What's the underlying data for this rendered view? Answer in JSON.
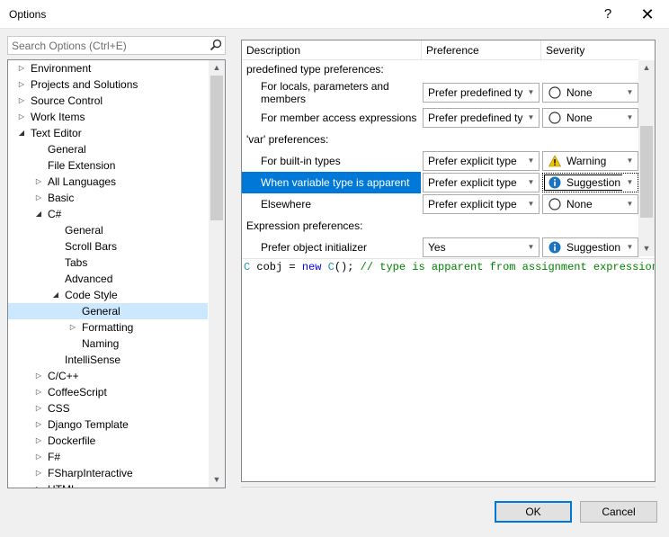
{
  "window": {
    "title": "Options",
    "help_label": "?",
    "close_label": "✕"
  },
  "search": {
    "placeholder": "Search Options (Ctrl+E)"
  },
  "tree": {
    "items": [
      {
        "label": "Environment",
        "level": 0,
        "glyph": "▷"
      },
      {
        "label": "Projects and Solutions",
        "level": 0,
        "glyph": "▷"
      },
      {
        "label": "Source Control",
        "level": 0,
        "glyph": "▷"
      },
      {
        "label": "Work Items",
        "level": 0,
        "glyph": "▷"
      },
      {
        "label": "Text Editor",
        "level": 0,
        "glyph": "◢"
      },
      {
        "label": "General",
        "level": 1,
        "glyph": ""
      },
      {
        "label": "File Extension",
        "level": 1,
        "glyph": ""
      },
      {
        "label": "All Languages",
        "level": 1,
        "glyph": "▷"
      },
      {
        "label": "Basic",
        "level": 1,
        "glyph": "▷"
      },
      {
        "label": "C#",
        "level": 1,
        "glyph": "◢"
      },
      {
        "label": "General",
        "level": 2,
        "glyph": ""
      },
      {
        "label": "Scroll Bars",
        "level": 2,
        "glyph": ""
      },
      {
        "label": "Tabs",
        "level": 2,
        "glyph": ""
      },
      {
        "label": "Advanced",
        "level": 2,
        "glyph": ""
      },
      {
        "label": "Code Style",
        "level": 2,
        "glyph": "◢"
      },
      {
        "label": "General",
        "level": 3,
        "glyph": "",
        "selected": true
      },
      {
        "label": "Formatting",
        "level": 3,
        "glyph": "▷"
      },
      {
        "label": "Naming",
        "level": 3,
        "glyph": ""
      },
      {
        "label": "IntelliSense",
        "level": 2,
        "glyph": ""
      },
      {
        "label": "C/C++",
        "level": 1,
        "glyph": "▷"
      },
      {
        "label": "CoffeeScript",
        "level": 1,
        "glyph": "▷"
      },
      {
        "label": "CSS",
        "level": 1,
        "glyph": "▷"
      },
      {
        "label": "Django Template",
        "level": 1,
        "glyph": "▷"
      },
      {
        "label": "Dockerfile",
        "level": 1,
        "glyph": "▷"
      },
      {
        "label": "F#",
        "level": 1,
        "glyph": "▷"
      },
      {
        "label": "FSharpInteractive",
        "level": 1,
        "glyph": "▷"
      },
      {
        "label": "HTML",
        "level": 1,
        "glyph": "▷"
      }
    ]
  },
  "grid": {
    "headers": {
      "description": "Description",
      "preference": "Preference",
      "severity": "Severity"
    },
    "rows": [
      {
        "kind": "group",
        "label": "predefined type preferences:"
      },
      {
        "kind": "item",
        "label": "For locals, parameters and members",
        "preference": "Prefer predefined type",
        "severity": "None",
        "sev_icon": "none"
      },
      {
        "kind": "item",
        "label": "For member access expressions",
        "preference": "Prefer predefined type",
        "severity": "None",
        "sev_icon": "none"
      },
      {
        "kind": "group",
        "label": "'var' preferences:"
      },
      {
        "kind": "item",
        "label": "For built-in types",
        "preference": "Prefer explicit type",
        "severity": "Warning",
        "sev_icon": "warning"
      },
      {
        "kind": "item",
        "label": "When variable type is apparent",
        "preference": "Prefer explicit type",
        "severity": "Suggestion",
        "sev_icon": "info",
        "highlighted": true,
        "focused": true
      },
      {
        "kind": "item",
        "label": "Elsewhere",
        "preference": "Prefer explicit type",
        "severity": "None",
        "sev_icon": "none"
      },
      {
        "kind": "group",
        "label": "Expression preferences:"
      },
      {
        "kind": "item",
        "label": "Prefer object initializer",
        "preference": "Yes",
        "severity": "Suggestion",
        "sev_icon": "info"
      }
    ]
  },
  "preview": {
    "type1": "C",
    "var": " cobj = ",
    "kw": "new",
    "type2": " C",
    "rest": "(); ",
    "comment": "// type is apparent from assignment expression"
  },
  "buttons": {
    "ok": "OK",
    "cancel": "Cancel"
  },
  "colors": {
    "accent": "#0078d7",
    "selected_tree": "#cce8ff",
    "warning": "#f5c400",
    "info": "#1e73be"
  }
}
